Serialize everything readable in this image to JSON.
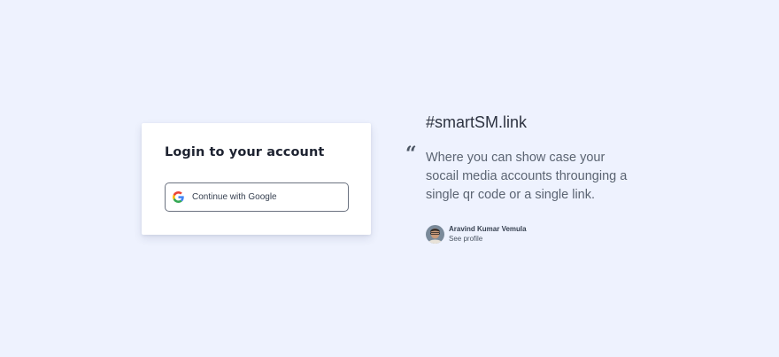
{
  "login": {
    "title": "Login to your account",
    "google_button_label": "Continue with Google",
    "google_icon": "google-g-icon"
  },
  "testimonial": {
    "tagline": "#smartSM.link",
    "quote_icon": "quote-icon",
    "quote_mark": "“",
    "quote": "Where you can show case your socail media accounts throunging a single qr code or a single link.",
    "author_name": "Aravind Kumar Vemula",
    "author_link": "See profile"
  },
  "colors": {
    "background": "#eef2fe",
    "card": "#ffffff",
    "title_text": "#1e2331",
    "quote_text": "#5b6472"
  }
}
